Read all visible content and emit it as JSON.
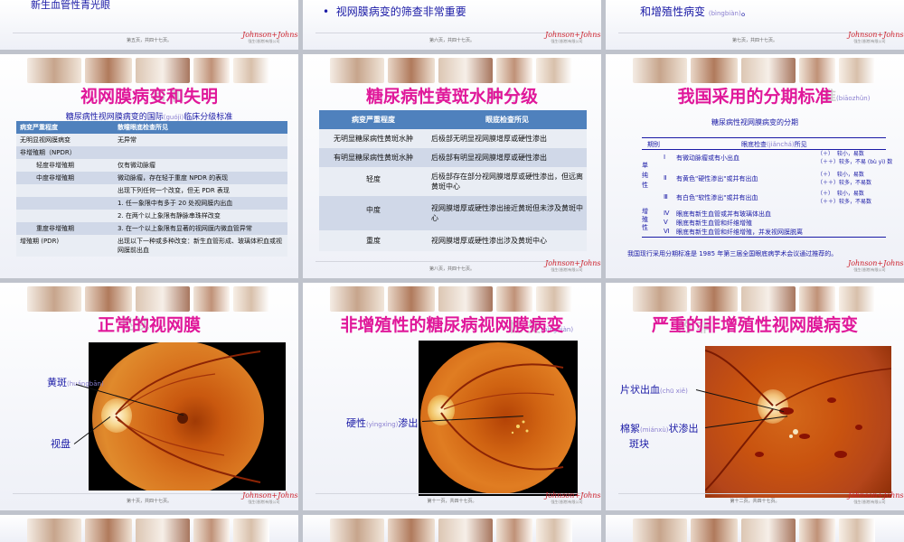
{
  "top_row": {
    "left_text": "新生血管性青光眼",
    "middle_bullet": "视网膜病变的筛查非常重要",
    "right_text": "和增殖性病变",
    "right_pinyin": "(bìngbiàn)",
    "right_suffix": "。",
    "page_left": "第五页，共四十七页。",
    "page_middle": "第六页，共四十七页。",
    "page_right": "第七页，共四十七页。"
  },
  "logo": {
    "script": "Johnson+Johnson",
    "sub": "强生(香港)有限公司"
  },
  "slide1": {
    "title": "视网膜病变和失明",
    "ghost": "和 和",
    "subtitle_a": "糖尿病性视网膜病变的国际",
    "subtitle_pinyin": "(guójì)",
    "subtitle_b": "临床分级标准",
    "headers": [
      "病变严重程度",
      "散瞳眼底检查所见"
    ],
    "rows": [
      [
        "无明显视网膜病变",
        "无异常"
      ],
      [
        "非增殖期（NPDR）",
        ""
      ],
      [
        "轻度非增殖期",
        "仅有微动脉瘤"
      ],
      [
        "中度非增殖期",
        "微动脉瘤，存在轻于重度 NPDR 的表现"
      ],
      [
        "",
        "出现下列任何一个改变，但无 PDR 表现"
      ],
      [
        "",
        "1. 任一象限中有多于 20 处视网膜内出血"
      ],
      [
        "",
        "2. 在两个以上象限有静脉串珠样改变"
      ],
      [
        "重度非增殖期",
        "3. 在一个以上象限有显著的视网膜内微血管异常"
      ],
      [
        "增殖期 (PDR)",
        "出现以下一种或多种改变：新生血管形成、玻璃体积血或视网膜前出血"
      ]
    ]
  },
  "slide2": {
    "title": "糖尿病性黄斑水肿分级",
    "ghost": "肿 分",
    "headers": [
      "病变严重程度",
      "眼底检查所见"
    ],
    "rows": [
      [
        "无明显糖尿病性黄斑水肿",
        "后极部无明显视网膜增厚或硬性渗出"
      ],
      [
        "有明显糖尿病性黄斑水肿",
        "后极部有明显视网膜增厚或硬性渗出"
      ],
      [
        "轻度",
        "后极部存在部分视网膜增厚或硬性渗出，但远离黄斑中心"
      ],
      [
        "中度",
        "视网膜增厚或硬性渗出接近黄斑但未涉及黄斑中心"
      ],
      [
        "重度",
        "视网膜增厚或硬性渗出涉及黄斑中心"
      ]
    ],
    "page": "第八页，共四十七页。"
  },
  "slide3": {
    "title": "我国采用的分期标准",
    "ghost": "准",
    "ghost_pinyin": "(biāozhǔn)",
    "subtitle": "糖尿病性视网膜病变的分期",
    "head_stage": "期别",
    "head_finding_a": "眼底检查",
    "head_finding_pinyin": "(jiǎnchá)",
    "head_finding_b": "所见",
    "group1": "单纯性",
    "group2": "增殖性",
    "rows": [
      [
        "Ⅰ",
        "有微动脉瘤或有小出血",
        "（＋）  较小，易数\n（＋＋）较多，不易 (bù yì) 数"
      ],
      [
        "Ⅱ",
        "有黄色\"硬性渗出\"或并有出血",
        "（＋）  较小，易数\n（＋＋）较多，不易数"
      ],
      [
        "Ⅲ",
        "有白色\"软性渗出\"或并有出血",
        "（＋）  较小，易数\n（＋＋）较多，不易数"
      ],
      [
        "Ⅳ",
        "眼底有新生血管或并有玻璃体出血",
        ""
      ],
      [
        "Ⅴ",
        "眼底有新生血管和纤维增殖",
        ""
      ],
      [
        "Ⅵ",
        "眼底有新生血管和纤维增殖，并发视网膜脱离",
        ""
      ]
    ],
    "note": "我国现行采用分期标准是 1985 年第三届全国眼底病学术会议通过推荐的。"
  },
  "slide4": {
    "title": "正常的视网膜",
    "ghost": "的视",
    "label_macula": "黄斑",
    "label_macula_pinyin": "(huángbān)",
    "label_disc": "视盘",
    "page": "第十页，共四十七页。"
  },
  "slide5": {
    "title": "非增殖性的糖尿病视网膜病变",
    "ghost": "性 变",
    "ghost_pinyin": "(bìngbiàn)",
    "label_a": "硬性",
    "label_pinyin": "(yìngxìng)",
    "label_b": "渗出",
    "page": "第十一页，共四十七页。"
  },
  "slide6": {
    "title": "严重的非增殖性视网膜病变",
    "ghost": "的 非",
    "label1_a": "片状出血",
    "label1_pinyin": "(chū xiě)",
    "label2_a": "棉絮",
    "label2_pinyin": "(miánxù)",
    "label2_b": "状渗出",
    "label2_c": "斑块",
    "page": "第十二页，共四十七页。"
  },
  "colors": {
    "title": "#e0189a",
    "table_header": "#4f81bd",
    "label": "#1a1aa6",
    "fundus": "#c9530f"
  }
}
